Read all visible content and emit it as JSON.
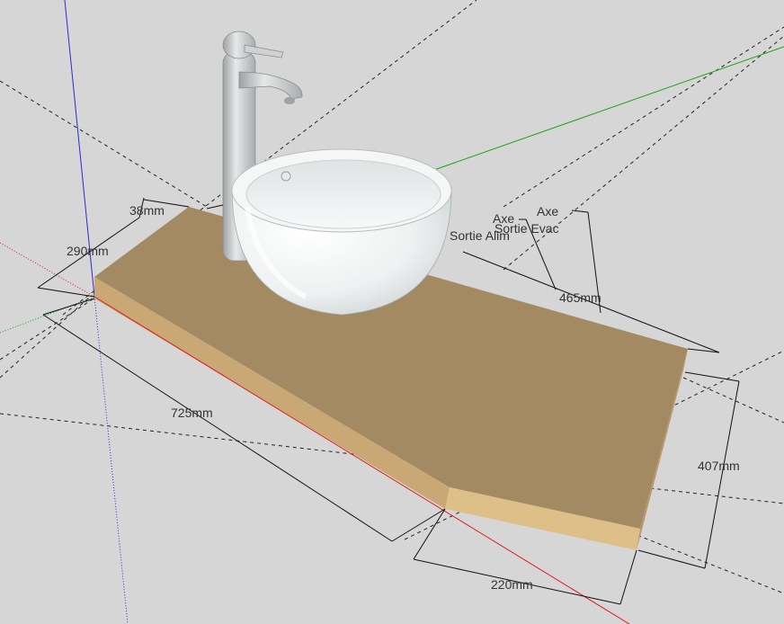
{
  "scene": {
    "background": "#d6d6d6",
    "axis_colors": {
      "blue": "#2a2adf",
      "green": "#19a319",
      "red": "#e01b1b"
    },
    "countertop_colors": {
      "top": "#a48a63",
      "front": "#c9a875",
      "side": "#ddc087"
    },
    "basin_color": "#f3f5f5",
    "faucet_color": "#bfc2c4"
  },
  "dimensions": {
    "d38": "38mm",
    "d290": "290mm",
    "d725": "725mm",
    "d465": "465mm",
    "d407": "407mm",
    "d220": "220mm"
  },
  "labels": {
    "axe_1": "Axe",
    "axe_2": "Axe",
    "sortie_alim": "Sortie Alim",
    "sortie_evac": "Sortie Evac"
  }
}
